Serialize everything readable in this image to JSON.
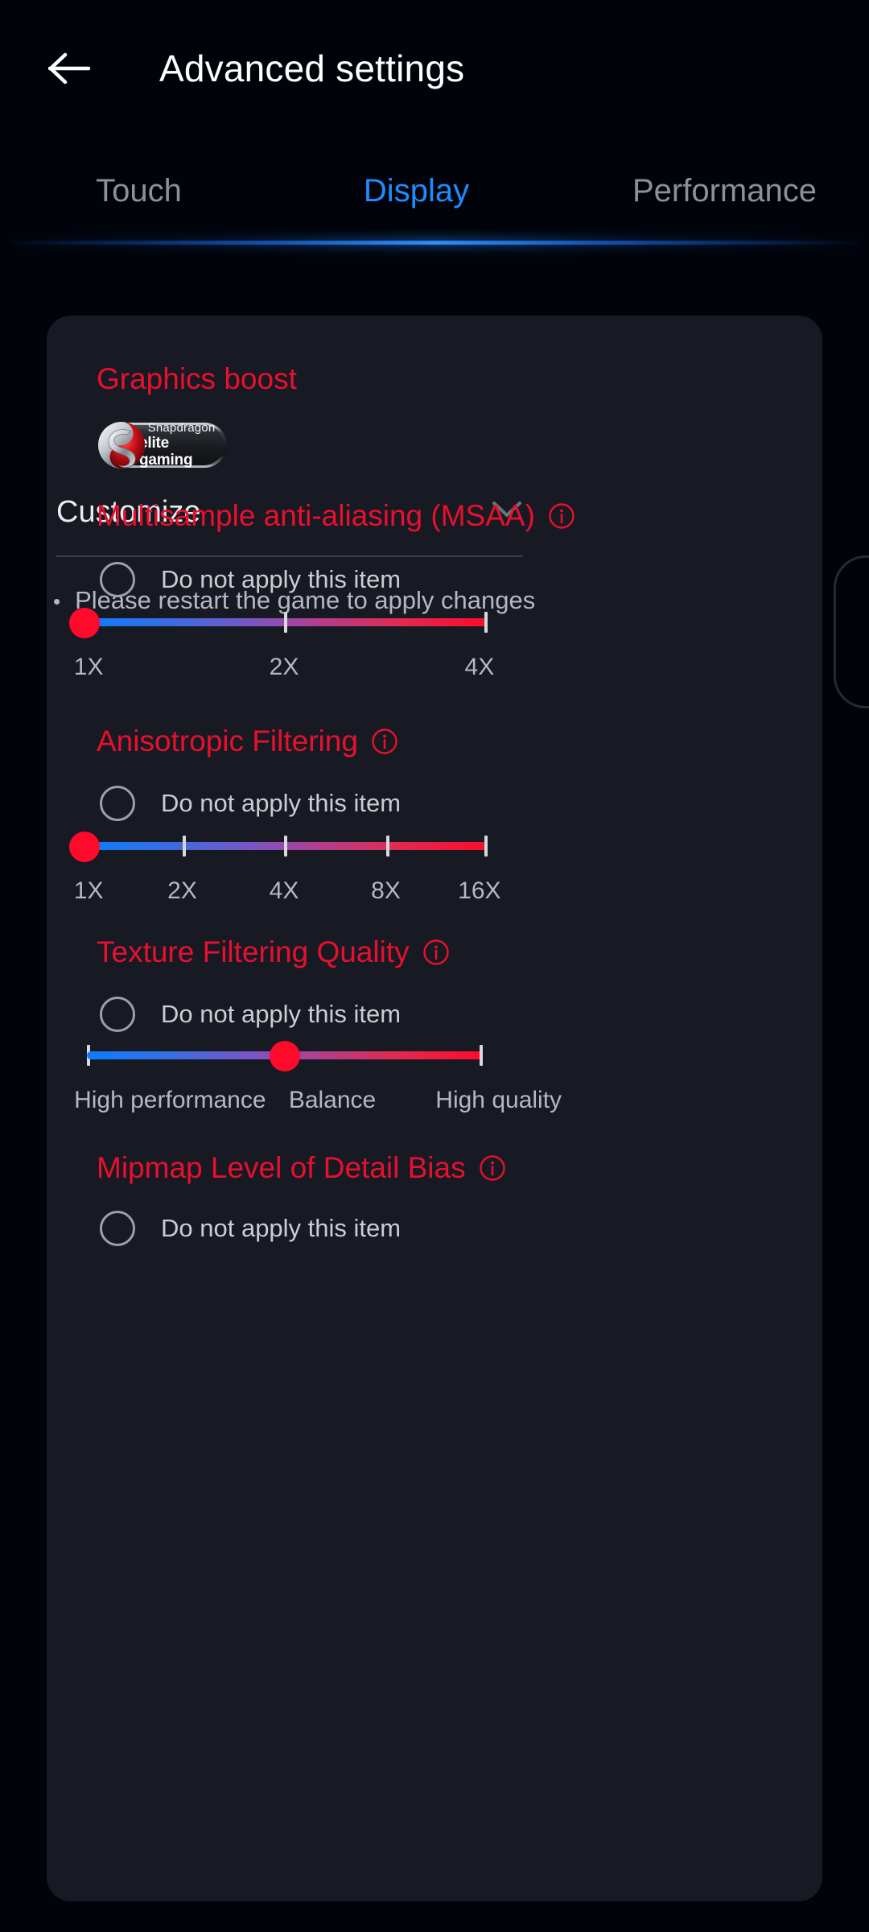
{
  "header": {
    "back_icon": "arrow-left-icon",
    "title": "Advanced settings"
  },
  "tabs": {
    "items": [
      {
        "label": "Touch",
        "active": false
      },
      {
        "label": "Display",
        "active": true
      },
      {
        "label": "Performance",
        "active": false
      }
    ],
    "active_color": "#1e8bff",
    "inactive_color": "#8b9099"
  },
  "card": {
    "graphics_boost": {
      "title": "Graphics boost",
      "badge": {
        "line1": "Snapdragon",
        "line2": "elite gaming",
        "logo_icon": "snapdragon-logo-icon"
      },
      "dropdown": {
        "value": "Customize",
        "chevron_icon": "chevron-down-icon"
      },
      "hint_bullet": "•",
      "hint": "Please restart the game to apply changes"
    },
    "sections": [
      {
        "title": "Multisample anti-aliasing (MSAA)",
        "info_icon": "info-circle-icon",
        "radio": {
          "label": "Do not apply this item",
          "checked": false
        },
        "slider": {
          "labels": [
            "1X",
            "2X",
            "4X"
          ],
          "tick_positions_pct": [
            50,
            100
          ],
          "thumb_position_pct": 0,
          "selected_value": "1X"
        }
      },
      {
        "title": "Anisotropic Filtering",
        "info_icon": "info-circle-icon",
        "radio": {
          "label": "Do not apply this item",
          "checked": false
        },
        "slider": {
          "labels": [
            "1X",
            "2X",
            "4X",
            "8X",
            "16X"
          ],
          "tick_positions_pct": [
            25,
            50,
            75,
            100
          ],
          "thumb_position_pct": 0,
          "selected_value": "1X"
        }
      },
      {
        "title": "Texture Filtering Quality",
        "info_icon": "info-circle-icon",
        "radio": {
          "label": "Do not apply this item",
          "checked": false
        },
        "slider": {
          "labels": [
            "High performance",
            "Balance",
            "High quality"
          ],
          "tick_positions_pct": [],
          "thumb_position_pct": 50,
          "selected_value": "Balance"
        }
      },
      {
        "title": "Mipmap Level of Detail Bias",
        "info_icon": "info-circle-icon",
        "radio": {
          "label": "Do not apply this item",
          "checked": false
        }
      }
    ]
  },
  "colors": {
    "page_background": "#00040a",
    "card_background": "#171a22",
    "accent_red": "#e8102e",
    "accent_blue": "#1e8bff",
    "slider_thumb": "#ff0a2b",
    "muted_text": "#b3b8c1"
  }
}
